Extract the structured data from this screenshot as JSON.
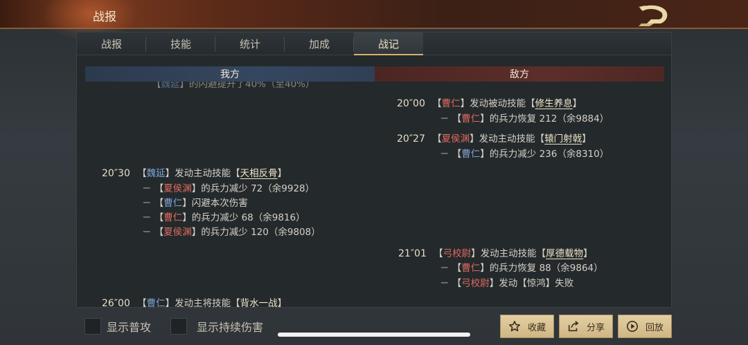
{
  "header": {
    "title": "战报"
  },
  "tabs": [
    {
      "label": "战报",
      "active": false
    },
    {
      "label": "技能",
      "active": false
    },
    {
      "label": "统计",
      "active": false
    },
    {
      "label": "加成",
      "active": false
    },
    {
      "label": "战记",
      "active": true
    }
  ],
  "columns": {
    "left": "我方",
    "right": "敌方"
  },
  "log": {
    "cut_line": {
      "bracket_open": "【",
      "name": "魏延",
      "bracket_close": "】",
      "text": "的闪避提升了40%（至40%）"
    },
    "e1": {
      "time": "20″00",
      "actor_open": "【",
      "actor": "曹仁",
      "actor_close": "】",
      "action": "发动被动技能【",
      "skill": "修生养息",
      "action_end": "】",
      "sub": [
        {
          "dash": "－",
          "open": "【",
          "target": "曹仁",
          "close": "】",
          "text": "的兵力恢复 212（余9884）"
        }
      ]
    },
    "e2": {
      "time": "20″27",
      "actor_open": "【",
      "actor": "夏侯渊",
      "actor_close": "】",
      "action": "发动主动技能【",
      "skill": "辕门射戟",
      "action_end": "】",
      "sub": [
        {
          "dash": "－",
          "open": "【",
          "target": "曹仁",
          "close": "】",
          "text": "的兵力减少 236（余8310）"
        }
      ]
    },
    "e3": {
      "time": "20″30",
      "actor_open": "【",
      "actor": "魏延",
      "actor_close": "】",
      "action": "发动主动技能【",
      "skill": "天相反骨",
      "action_end": "】",
      "sub": [
        {
          "dash": "－",
          "open": "【",
          "target": "夏侯渊",
          "close": "】",
          "text": "的兵力减少 72（余9928）"
        },
        {
          "dash": "－",
          "open": "【",
          "target": "曹仁",
          "close": "】",
          "text": "闪避本次伤害"
        },
        {
          "dash": "－",
          "open": "【",
          "target": "曹仁",
          "close": "】",
          "text": "的兵力减少 68（余9816）"
        },
        {
          "dash": "－",
          "open": "【",
          "target": "夏侯渊",
          "close": "】",
          "text": "的兵力减少 120（余9808）"
        }
      ]
    },
    "e4": {
      "time": "21″01",
      "actor_open": "【",
      "actor": "弓校尉",
      "actor_close": "】",
      "action": "发动主动技能【",
      "skill": "厚德载物",
      "action_end": "】",
      "sub": [
        {
          "dash": "－",
          "open": "【",
          "target": "曹仁",
          "close": "】",
          "text": "的兵力恢复 88（余9864）"
        },
        {
          "dash": "－",
          "open": "【",
          "target": "弓校尉",
          "close": "】",
          "text": "发动【惊鸿】失败"
        }
      ]
    },
    "e5": {
      "time": "26″00",
      "actor_open": "【",
      "actor": "曹仁",
      "actor_close": "】",
      "action": "发动主将技能【",
      "skill": "背水一战",
      "action_end": "】"
    }
  },
  "options": {
    "show_normal_attack": "显示普攻",
    "show_dot": "显示持续伤害"
  },
  "actions": {
    "favorite": "收藏",
    "share": "分享",
    "replay": "回放"
  },
  "colors": {
    "ally_name": "#7ea3d4",
    "enemy_name": "#e06a5e",
    "button_gold": "#d9c393"
  },
  "icons": {
    "back": "dragon-back-icon",
    "favorite": "star-icon",
    "share": "share-icon",
    "replay": "play-icon"
  }
}
